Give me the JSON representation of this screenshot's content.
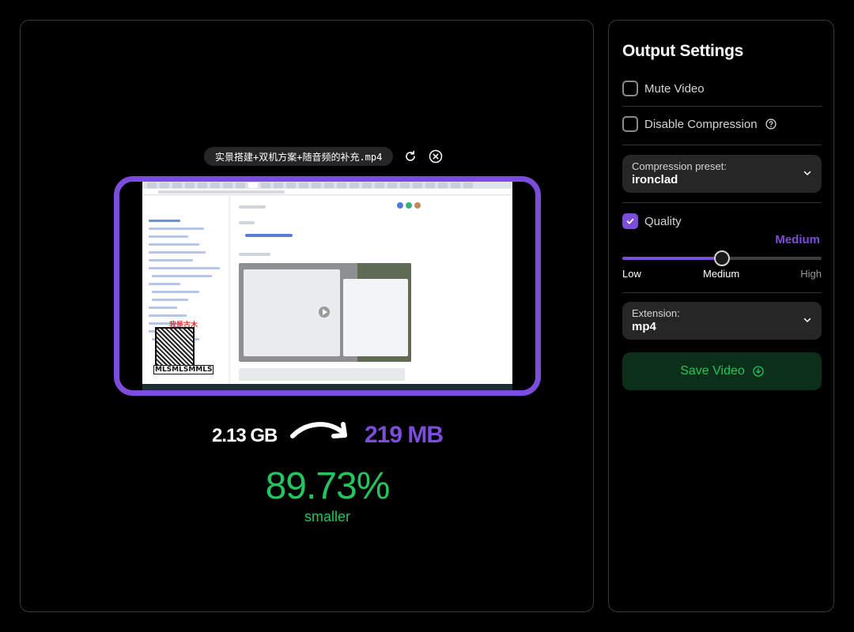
{
  "preview": {
    "file_name": "实景搭建+双机方案+随音频的补充.mp4",
    "embedded": {
      "red_label": "我是古木",
      "qr_label": "MLSMLSMMLS"
    }
  },
  "stats": {
    "original_size": "2.13 GB",
    "compressed_size": "219 MB",
    "reduction_percent": "89.73%",
    "reduction_label": "smaller"
  },
  "settings": {
    "title": "Output Settings",
    "mute_video": {
      "label": "Mute Video",
      "checked": false
    },
    "disable_compression": {
      "label": "Disable Compression",
      "checked": false
    },
    "compression_preset": {
      "label": "Compression preset:",
      "value": "ironclad"
    },
    "quality": {
      "label": "Quality",
      "checked": true,
      "current": "Medium",
      "value_fraction": 0.5,
      "levels": [
        "Low",
        "Medium",
        "High"
      ]
    },
    "extension": {
      "label": "Extension:",
      "value": "mp4"
    },
    "save_label": "Save Video"
  },
  "colors": {
    "accent": "#7c4ddb",
    "success": "#22c55e",
    "save_bg": "#0c2f1a",
    "panel_border": "#3a3a3a",
    "control_bg": "#262626"
  }
}
